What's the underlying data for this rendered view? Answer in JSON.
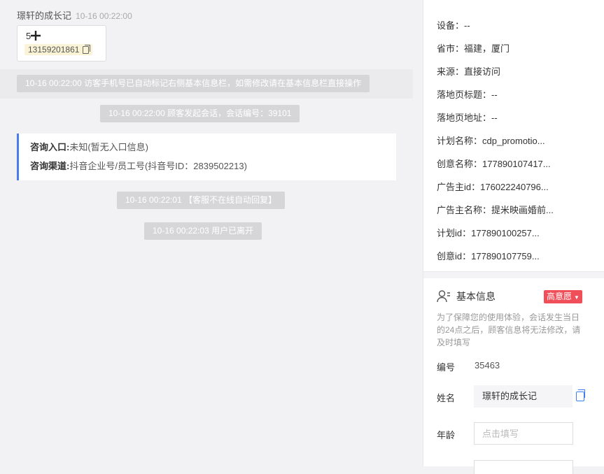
{
  "chat": {
    "customer_name": "璟轩的成长记",
    "first_time": "10-16 00:22:00",
    "message_text": "5",
    "phone": "13159201861",
    "system_notes": [
      "10-16 00:22:00 访客手机号已自动标记右侧基本信息栏，如需修改请在基本信息栏直接操作",
      "10-16 00:22:00 顾客发起会话，会话编号：39101",
      "10-16 00:22:01 【客服不在线自动回复】",
      "10-16 00:22:03 用户已离开"
    ],
    "consult": {
      "entry_label": "咨询入口:",
      "entry_value": "未知(暂无入口信息)",
      "channel_label": "咨询渠道:",
      "channel_value": "抖音企业号/员工号(抖音号ID：2839502213)"
    }
  },
  "visit_info": [
    {
      "label": "设备：",
      "value": "--"
    },
    {
      "label": "省市：",
      "value": "福建，厦门"
    },
    {
      "label": "来源：",
      "value": "直接访问"
    },
    {
      "label": "落地页标题：",
      "value": "--"
    },
    {
      "label": "落地页地址：",
      "value": "--"
    },
    {
      "label": "计划名称：",
      "value": "cdp_promotio..."
    },
    {
      "label": "创意名称：",
      "value": "177890107417..."
    },
    {
      "label": "广告主id：",
      "value": "176022240796..."
    },
    {
      "label": "广告主名称：",
      "value": "提米映画婚前..."
    },
    {
      "label": "计划id：",
      "value": "177890100257..."
    },
    {
      "label": "创意id：",
      "value": "177890107759..."
    }
  ],
  "basic_info": {
    "title": "基本信息",
    "intent_tag": "高意愿",
    "hint": "为了保障您的使用体验，会话发生当日的24点之后，顾客信息将无法修改，请及时填写",
    "id_label": "编号",
    "id_value": "35463",
    "name_label": "姓名",
    "name_value": "璟轩的成长记",
    "age_label": "年龄",
    "age_placeholder": "点击填写"
  },
  "colors": {
    "accent_blue": "#4a7cf0",
    "tag_red": "#f04f5a",
    "phone_chip": "#fbf3d5"
  },
  "icons": [
    "copy-icon",
    "cursor-icon",
    "user-icon",
    "caret-down-icon"
  ]
}
